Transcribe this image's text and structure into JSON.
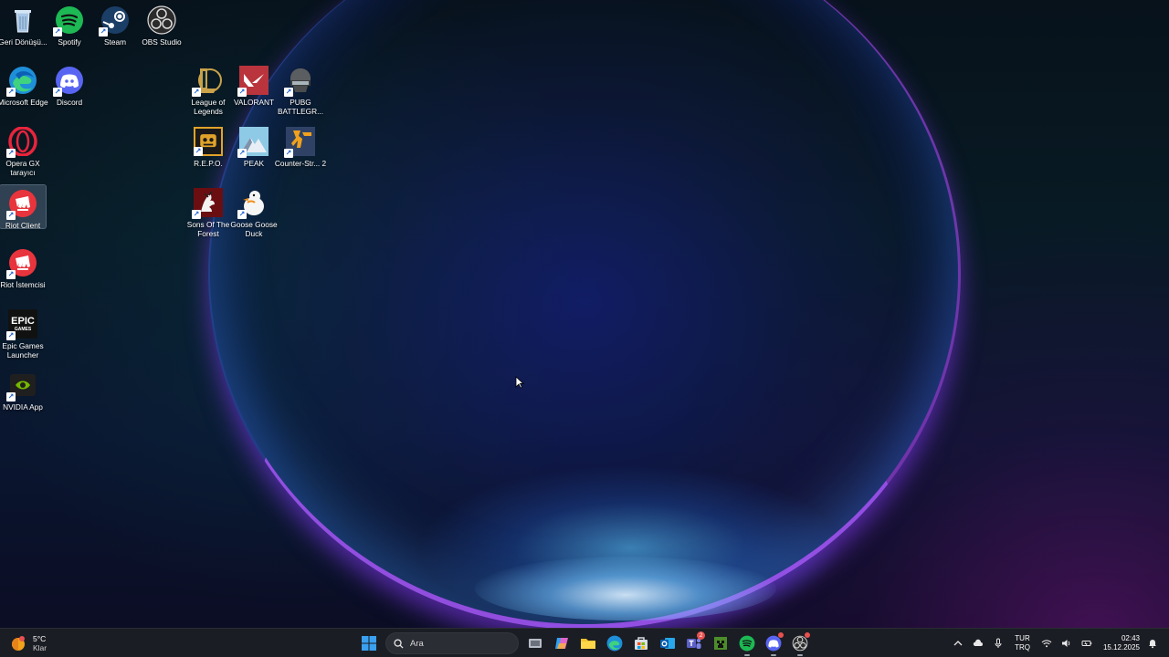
{
  "desktop": {
    "icons": [
      {
        "label": "Geri Dönüşü...",
        "icon": "recycle-bin-icon"
      },
      {
        "label": "Spotify",
        "icon": "spotify-icon"
      },
      {
        "label": "Steam",
        "icon": "steam-icon"
      },
      {
        "label": "OBS Studio",
        "icon": "obs-icon"
      },
      {
        "label": "Microsoft Edge",
        "icon": "edge-icon"
      },
      {
        "label": "Discord",
        "icon": "discord-icon"
      },
      {
        "label": "Opera GX tarayıcı",
        "icon": "opera-gx-icon"
      },
      {
        "label": "Riot Client",
        "icon": "riot-client-icon",
        "selected": true
      },
      {
        "label": "Riot İstemcisi",
        "icon": "riot-client-icon"
      },
      {
        "label": "Epic Games Launcher",
        "icon": "epic-games-icon"
      },
      {
        "label": "NVIDIA App",
        "icon": "nvidia-icon"
      },
      {
        "label": "League of Legends",
        "icon": "league-of-legends-icon"
      },
      {
        "label": "VALORANT",
        "icon": "valorant-icon"
      },
      {
        "label": "PUBG BATTLEGR...",
        "icon": "pubg-icon"
      },
      {
        "label": "R.E.P.O.",
        "icon": "repo-icon"
      },
      {
        "label": "PEAK",
        "icon": "peak-icon"
      },
      {
        "label": "Counter-Str... 2",
        "icon": "counter-strike-icon"
      },
      {
        "label": "Sons Of The Forest",
        "icon": "sons-of-the-forest-icon"
      },
      {
        "label": "Goose Goose Duck",
        "icon": "goose-goose-duck-icon"
      }
    ],
    "epic_icon_text": "EPIC",
    "epic_icon_subtext": "GAMES"
  },
  "taskbar": {
    "weather": {
      "temp": "5°C",
      "desc": "Klar",
      "icon": "weather-sun-icon"
    },
    "search": {
      "placeholder": "Ara"
    },
    "pinned": [
      {
        "name": "start",
        "icon": "windows-start-icon"
      },
      {
        "name": "task-view",
        "icon": "task-view-icon"
      },
      {
        "name": "copilot",
        "icon": "copilot-icon"
      },
      {
        "name": "file-explorer",
        "icon": "folder-icon"
      },
      {
        "name": "edge",
        "icon": "edge-icon"
      },
      {
        "name": "store",
        "icon": "store-icon"
      },
      {
        "name": "outlook",
        "icon": "outlook-icon"
      },
      {
        "name": "teams",
        "icon": "teams-icon",
        "badge": "2"
      },
      {
        "name": "minecraft",
        "icon": "minecraft-icon"
      },
      {
        "name": "spotify",
        "icon": "spotify-icon",
        "running": true
      },
      {
        "name": "discord",
        "icon": "discord-icon",
        "running": true
      },
      {
        "name": "obs",
        "icon": "obs-icon",
        "running": true
      }
    ],
    "tray": {
      "lang_top": "TUR",
      "lang_bottom": "TRQ",
      "time": "02:43",
      "date": "15.12.2025"
    }
  },
  "colors": {
    "taskbar_bg": "#1b1d24",
    "accent_blue": "#0078d4",
    "spotify_green": "#1db954",
    "discord_blurple": "#5865f2",
    "riot_red": "#e8343c",
    "opera_red": "#e8243c"
  }
}
